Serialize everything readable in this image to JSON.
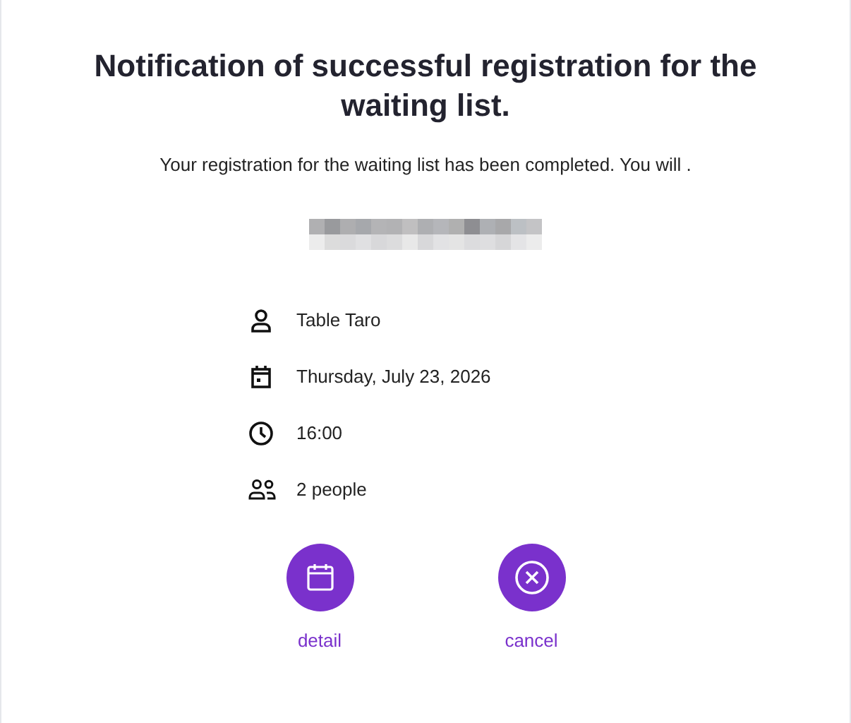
{
  "title": "Notification of successful registration for the waiting list.",
  "message": "Your registration for the waiting list has been completed. You will .",
  "details": [
    {
      "kind": "person",
      "text": "Table Taro"
    },
    {
      "kind": "date",
      "text": "Thursday, July 23, 2026"
    },
    {
      "kind": "time",
      "text": "16:00"
    },
    {
      "kind": "people",
      "text": "2 people"
    }
  ],
  "actions": [
    {
      "kind": "calendar",
      "label": "detail"
    },
    {
      "kind": "cancel",
      "label": "cancel"
    }
  ]
}
